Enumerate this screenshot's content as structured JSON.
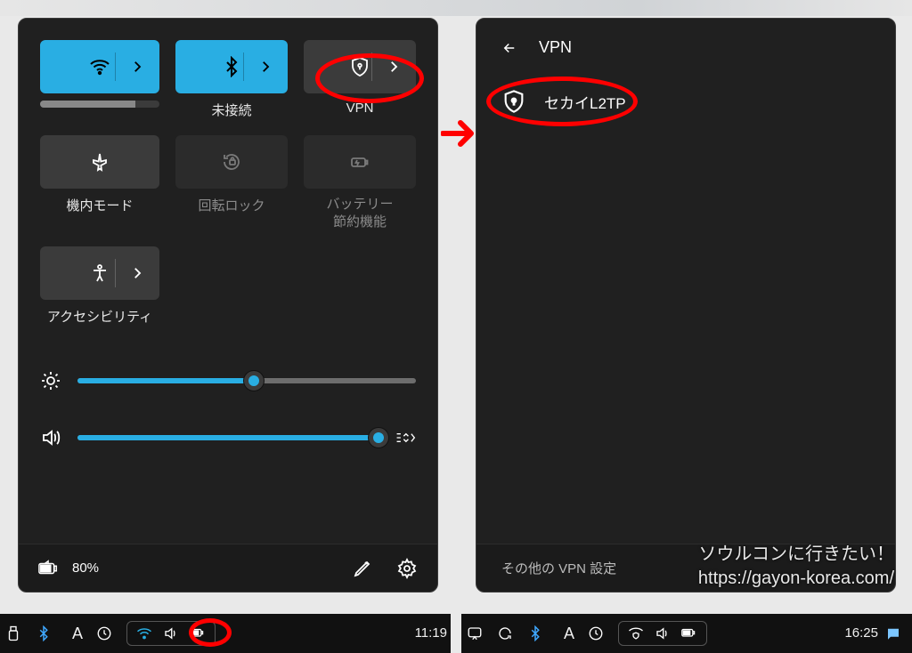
{
  "quick_panel": {
    "tiles": [
      {
        "id": "wifi",
        "label": "",
        "state": "on",
        "has_chev": true
      },
      {
        "id": "bluetooth",
        "label": "未接続",
        "state": "on",
        "has_chev": true
      },
      {
        "id": "vpn",
        "label": "VPN",
        "state": "off",
        "has_chev": true
      },
      {
        "id": "airplane",
        "label": "機内モード",
        "state": "off",
        "has_chev": false
      },
      {
        "id": "rotation",
        "label": "回転ロック",
        "state": "dis",
        "has_chev": false
      },
      {
        "id": "battery-saver",
        "label": "バッテリー\n節約機能",
        "state": "dis",
        "has_chev": false
      },
      {
        "id": "accessibility",
        "label": "アクセシビリティ",
        "state": "off",
        "has_chev": true
      }
    ],
    "brightness_pct": 52,
    "volume_pct": 100,
    "battery_label": "80%"
  },
  "vpn_panel": {
    "header": "VPN",
    "item": "セカイL2TP",
    "footer": "その他の VPN 設定"
  },
  "watermark": {
    "line1": "ソウルコンに行きたい！",
    "line2": "https://gayon-korea.com/"
  },
  "taskbars": {
    "left_time": "11:19",
    "right_time": "16:25"
  }
}
